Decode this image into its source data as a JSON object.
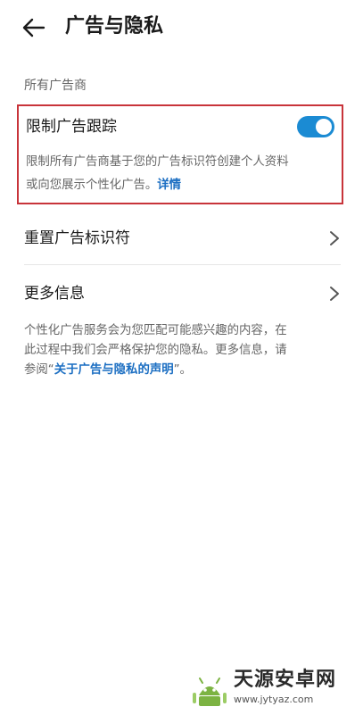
{
  "header": {
    "back_icon": "arrow-left-icon",
    "title": "广告与隐私"
  },
  "section": {
    "label": "所有广告商"
  },
  "limit_tracking": {
    "title": "限制广告跟踪",
    "toggle_on": true,
    "toggle_color": "#1b8bd3",
    "highlight_border_color": "#c8343a",
    "desc_line1": "限制所有广告商基于您的广告标识符创建个人资料",
    "desc_line2": "或向您展示个性化广告。",
    "details_link": "详情",
    "link_color": "#1b6ec2"
  },
  "list": {
    "reset_ad_id": "重置广告标识符",
    "more_info": "更多信息",
    "chevron_icon": "chevron-right-icon"
  },
  "info": {
    "line1": "个性化广告服务会为您匹配可能感兴趣的内容，在",
    "line2": "此过程中我们会严格保护您的隐私。更多信息，请",
    "line3_prefix": "参阅“",
    "statement_link": "关于广告与隐私的声明",
    "line3_suffix": "”。"
  },
  "watermark": {
    "title": "天源安卓网",
    "url": "www.jytyaz.com"
  }
}
